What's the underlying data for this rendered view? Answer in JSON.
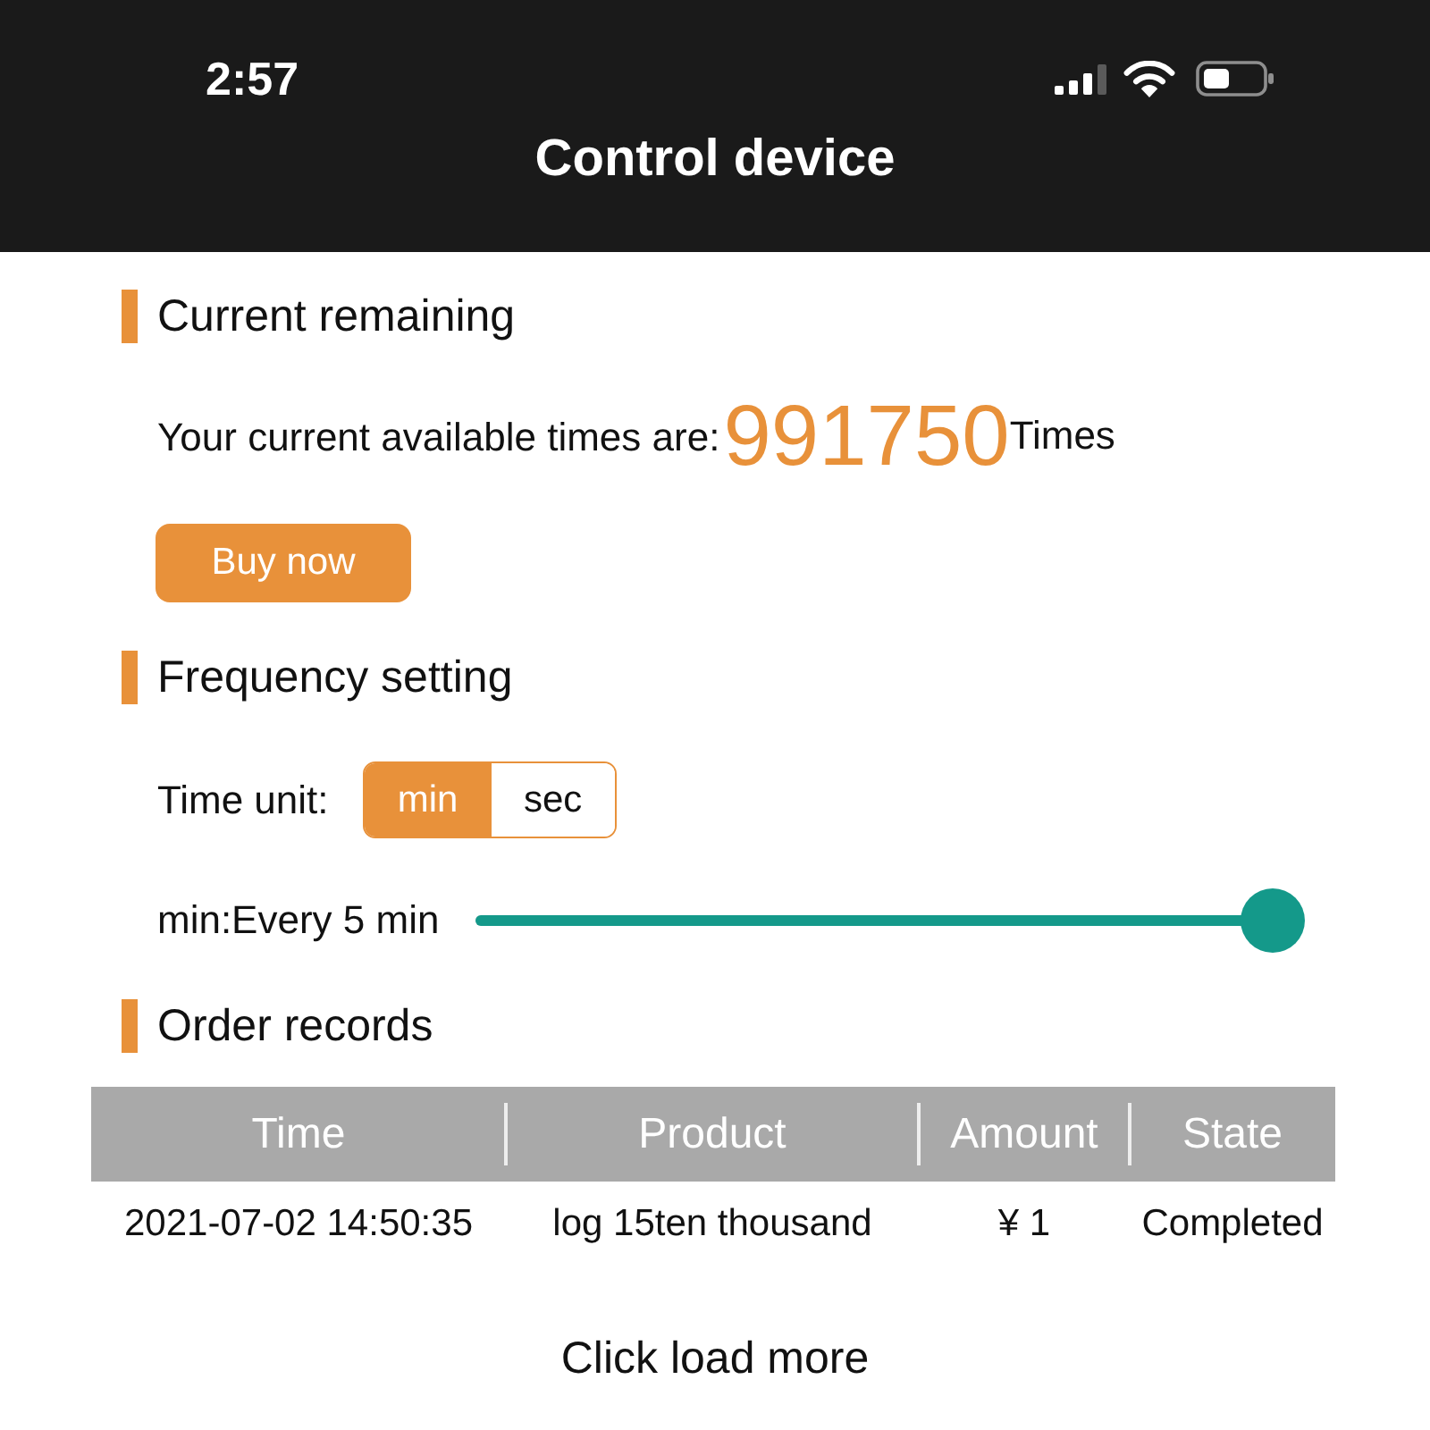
{
  "status_bar": {
    "time": "2:57"
  },
  "nav_bar": {
    "title": "Control device"
  },
  "sections": [
    {
      "kind": "remaining",
      "title": "Current remaining",
      "label": "Your current available times are:",
      "value": "991750",
      "unit": "Times",
      "button": "Buy now"
    },
    {
      "kind": "frequency",
      "title": "Frequency setting",
      "unit_label": "Time unit:",
      "units": [
        {
          "label": "min",
          "selected": true
        },
        {
          "label": "sec",
          "selected": false
        }
      ],
      "slider": {
        "label": "min:Every 5 min",
        "level": 1
      }
    },
    {
      "kind": "orders",
      "title": "Order records",
      "table": {
        "columns": [
          "Time",
          "Product",
          "Amount",
          "State"
        ],
        "rows": [
          [
            "2021-07-02 14:50:35",
            "log 15ten thousand",
            "¥ 1",
            "Completed"
          ]
        ]
      },
      "load_more": "Click load more"
    }
  ]
}
